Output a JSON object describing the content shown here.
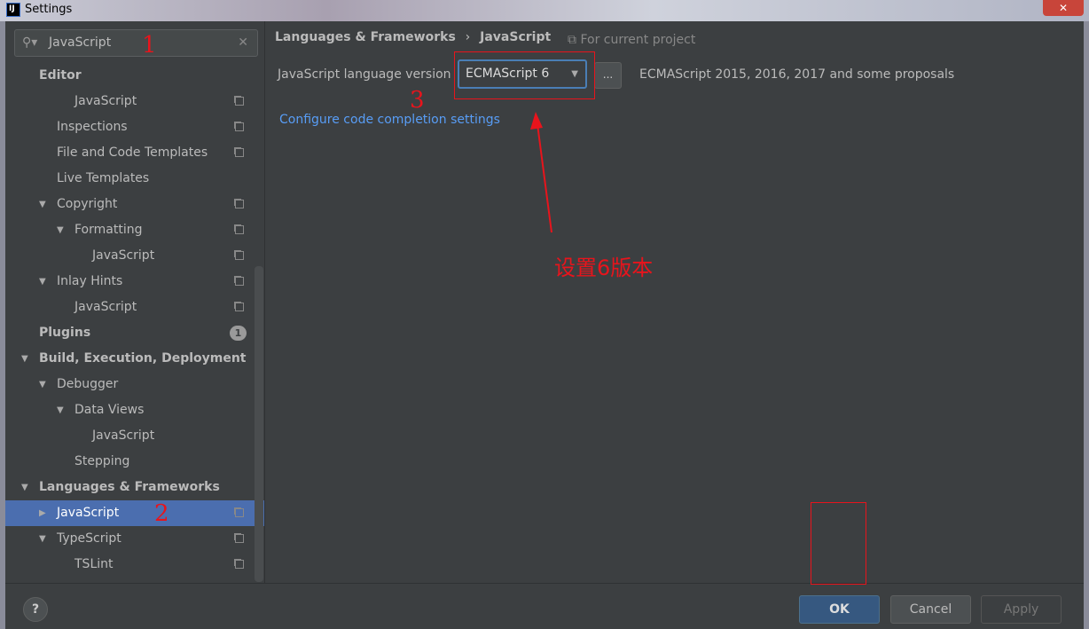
{
  "window": {
    "title": "Settings",
    "close_icon": "close-icon"
  },
  "sidebar": {
    "search": {
      "value": "JavaScript"
    },
    "items": [
      {
        "label": "Editor",
        "level": 0,
        "bold": true
      },
      {
        "label": "JavaScript",
        "level": 2,
        "copy": true
      },
      {
        "label": "Inspections",
        "level": 1,
        "copy": true
      },
      {
        "label": "File and Code Templates",
        "level": 1,
        "copy": true
      },
      {
        "label": "Live Templates",
        "level": 1
      },
      {
        "label": "Copyright",
        "level": 1,
        "arrow": "expanded",
        "copy": true
      },
      {
        "label": "Formatting",
        "level": 2,
        "arrow": "expanded",
        "copy": true
      },
      {
        "label": "JavaScript",
        "level": 3,
        "copy": true
      },
      {
        "label": "Inlay Hints",
        "level": 1,
        "arrow": "expanded",
        "copy": true
      },
      {
        "label": "JavaScript",
        "level": 2,
        "copy": true
      },
      {
        "label": "Plugins",
        "level": 0,
        "bold": true,
        "badge": "1"
      },
      {
        "label": "Build, Execution, Deployment",
        "level": 0,
        "bold": true,
        "arrow": "expanded"
      },
      {
        "label": "Debugger",
        "level": 1,
        "arrow": "expanded"
      },
      {
        "label": "Data Views",
        "level": 2,
        "arrow": "expanded"
      },
      {
        "label": "JavaScript",
        "level": 3
      },
      {
        "label": "Stepping",
        "level": 2
      },
      {
        "label": "Languages & Frameworks",
        "level": 0,
        "bold": true,
        "arrow": "expanded"
      },
      {
        "label": "JavaScript",
        "level": 1,
        "arrow": "collapsed",
        "copy": true,
        "selected": true
      },
      {
        "label": "TypeScript",
        "level": 1,
        "arrow": "expanded",
        "copy": true
      },
      {
        "label": "TSLint",
        "level": 2,
        "copy": true
      }
    ]
  },
  "main": {
    "breadcrumb": [
      "Languages & Frameworks",
      "JavaScript"
    ],
    "scope": "For current project",
    "version_label": "JavaScript language version",
    "version_value": "ECMAScript 6",
    "more_button": "...",
    "version_description": "ECMAScript 2015, 2016, 2017 and some proposals",
    "link": "Configure code completion settings"
  },
  "footer": {
    "help": "?",
    "ok": "OK",
    "cancel": "Cancel",
    "apply": "Apply"
  },
  "annotations": {
    "step1": "1",
    "step2": "2",
    "step3": "3",
    "note": "设置6版本",
    "color": "#e8141c"
  }
}
